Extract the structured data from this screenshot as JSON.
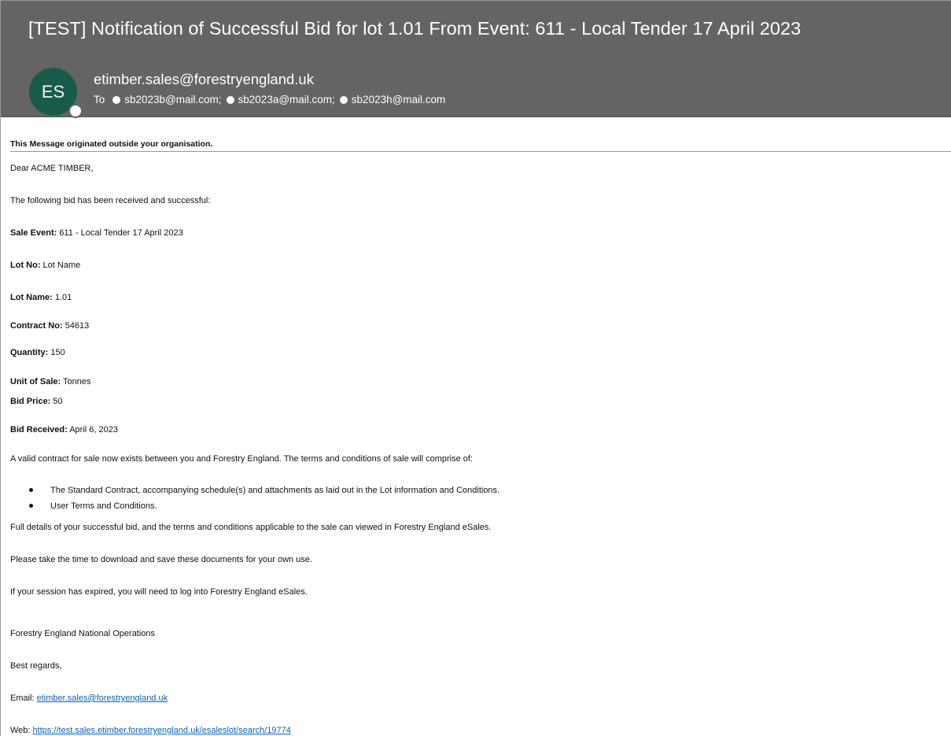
{
  "header": {
    "subject": "[TEST] Notification of Successful Bid for lot 1.01 From Event: 611 - Local Tender 17 April 2023",
    "avatar_initials": "ES",
    "avatar_color": "#175c4a",
    "sender": "etimber.sales@forestryengland.uk",
    "to_label": "To",
    "recipients": [
      "sb2023b@mail.com;",
      "sb2023a@mail.com;",
      "sb2023h@mail.com"
    ]
  },
  "body": {
    "external_notice": "This Message originated outside your organisation.",
    "greeting": "Dear ACME TIMBER,",
    "intro": "The following bid has been received and successful:",
    "fields": [
      {
        "label": "Sale Event:",
        "value": " 611 - Local Tender 17 April 2023"
      },
      {
        "label": "Lot No:",
        "value": " Lot Name"
      },
      {
        "label": "Lot Name:",
        "value": " 1.01"
      },
      {
        "label": "Contract No:",
        "value": " 54613"
      },
      {
        "label": "Quantity:",
        "value": " 150"
      },
      {
        "label": "Unit of Sale:",
        "value": " Tonnes"
      },
      {
        "label": "Bid Price:",
        "value": " 50"
      },
      {
        "label": "Bid Received:",
        "value": " April 6, 2023"
      }
    ],
    "contract_text": "A valid contract for sale now exists between you and Forestry England. The terms and conditions of sale will comprise of:",
    "bullets": [
      "The Standard Contract, accompanying schedule(s) and attachments as laid out in the Lot information and Conditions.",
      "User Terms and Conditions."
    ],
    "details_text": "Full details of your successful bid, and the terms and conditions applicable to the sale can viewed in Forestry England eSales.",
    "download_text": "Please take the time to download and save these documents for your own use.",
    "session_text": "If your session has expired, you will need to log into Forestry England eSales.",
    "signoff_org": "Forestry England National Operations",
    "regards": "Best regards,",
    "email_label": "Email: ",
    "email_link": "etimber.sales@forestryengland.uk",
    "web_label": "Web: ",
    "web_link": "https://test.sales.etimber.forestryengland.uk/esaleslot/search/19774"
  }
}
